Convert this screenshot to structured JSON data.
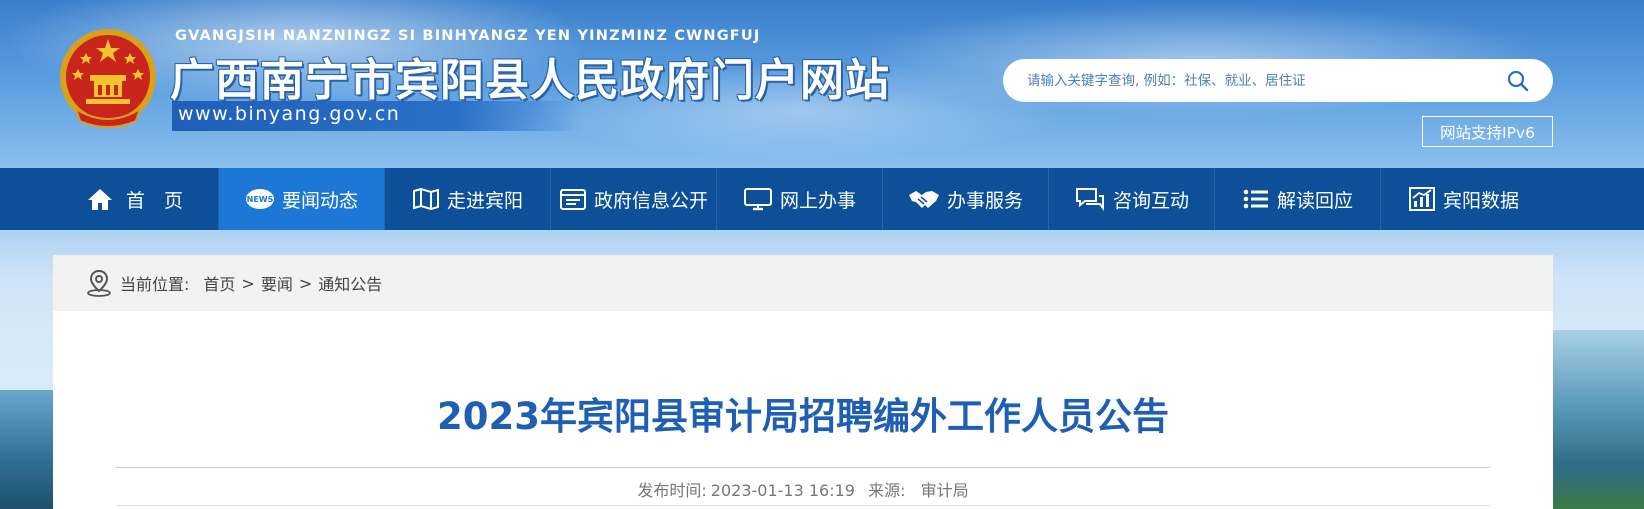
{
  "header": {
    "pinyin": "GVANGJSIH NANZNINGZ SI BINHYANGZ YEN YINZMINZ CWNGFUJ",
    "title": "广西南宁市宾阳县人民政府门户网站",
    "domain": "www.binyang.gov.cn",
    "search_placeholder": "请输入关键字查询, 例如：社保、就业、居住证",
    "ipv6_label": "网站支持IPv6"
  },
  "nav": {
    "items": [
      {
        "label": "首　页",
        "icon": "home-icon"
      },
      {
        "label": "要闻动态",
        "icon": "news-icon",
        "active": true
      },
      {
        "label": "走进宾阳",
        "icon": "map-icon"
      },
      {
        "label": "政府信息公开",
        "icon": "document-icon"
      },
      {
        "label": "网上办事",
        "icon": "monitor-icon"
      },
      {
        "label": "办事服务",
        "icon": "handshake-icon"
      },
      {
        "label": "咨询互动",
        "icon": "chat-icon"
      },
      {
        "label": "解读回应",
        "icon": "list-icon"
      },
      {
        "label": "宾阳数据",
        "icon": "bar-chart-icon"
      }
    ]
  },
  "breadcrumb": {
    "label": "当前位置:",
    "items": [
      "首页",
      "要闻",
      "通知公告"
    ],
    "separator": ">"
  },
  "article": {
    "title": "2023年宾阳县审计局招聘编外工作人员公告",
    "publish_label": "发布时间:",
    "publish_time": "2023-01-13 16:19",
    "source_label": "来源:",
    "source": "审计局"
  },
  "colors": {
    "nav_bg": "#0e4f99",
    "nav_active": "#1c77d6",
    "title_blue": "#1e5fb4"
  }
}
